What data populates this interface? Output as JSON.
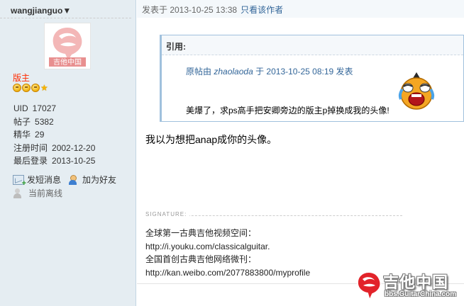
{
  "author": {
    "name": "wangjianguo",
    "avatar_logo_text": "吉他中国",
    "group_title": "版主",
    "stats": [
      {
        "label": "UID",
        "value": "17027"
      },
      {
        "label": "帖子",
        "value": "5382"
      },
      {
        "label": "精华",
        "value": "29"
      },
      {
        "label": "注册时间",
        "value": "2002-12-20"
      },
      {
        "label": "最后登录",
        "value": "2013-10-25"
      }
    ],
    "actions": {
      "message": "发短消息",
      "add_friend": "加为好友"
    },
    "status": "当前离线"
  },
  "post": {
    "posted_at": "发表于 2013-10-25 13:38",
    "only_author": "只看该作者",
    "quote": {
      "title": "引用:",
      "prefix": "原帖由",
      "quoted_user": "zhaolaoda",
      "suffix": "于 2013-10-25 08:19 发表",
      "text": "美爆了，求ps高手把安卿旁边的版主p掉换成我的头像!"
    },
    "body": "我以为想把anap成你的头像。",
    "signature_label": "SIGNATURE:",
    "signature_lines": [
      "全球第一古典吉他视频空间：",
      "http://i.youku.com/classicalguitar.",
      "全国首创古典吉他网络微刊：",
      "http://kan.weibo.com/2077883800/myprofile"
    ]
  },
  "watermark": {
    "title": "吉他中国",
    "subtitle": "bbs.GuitarChina.com"
  },
  "colors": {
    "sidebar_bg": "#e5edf2",
    "link": "#336699",
    "moderator": "#ff2a00",
    "quote_border": "#a0c1dd"
  }
}
